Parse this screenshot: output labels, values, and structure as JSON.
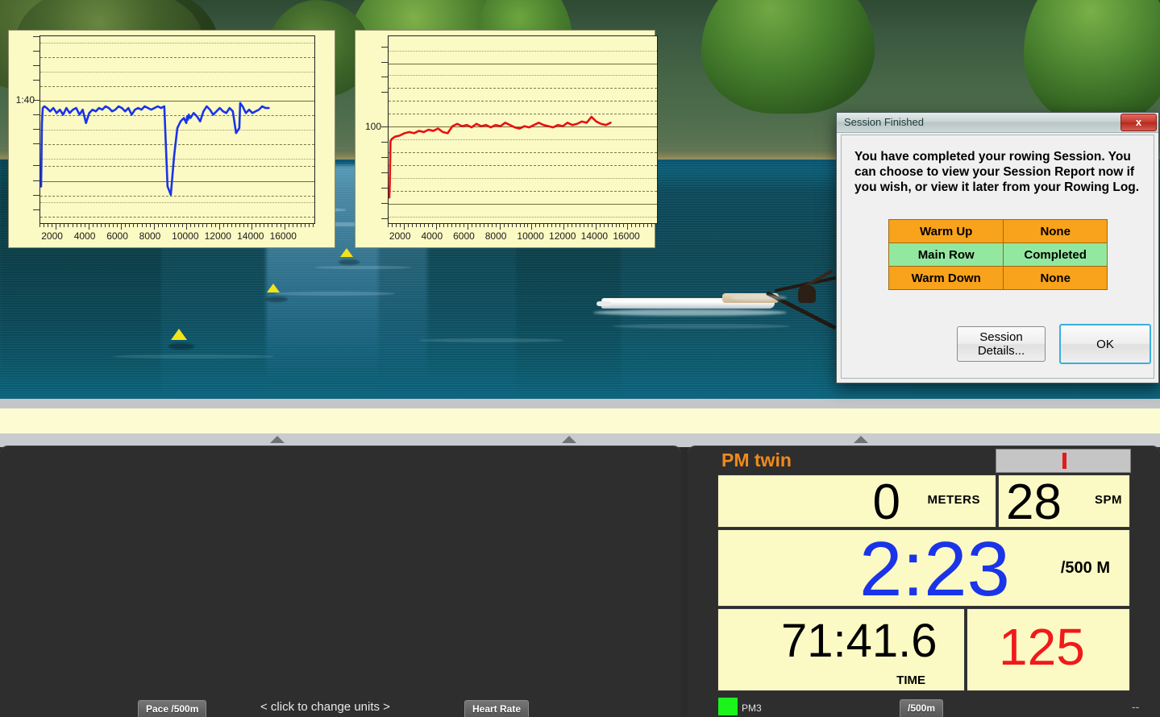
{
  "scene": {
    "name": "rowing-simulation-view",
    "buoys": 5,
    "boat": "single-scull"
  },
  "dialog": {
    "title": "Session Finished",
    "close_label": "x",
    "message": "You have completed your rowing Session.  You can choose to view your Session Report now if you wish, or view it later from your Rowing Log.",
    "table": {
      "rows": [
        {
          "label": "Warm Up",
          "status": "None",
          "color": "#f9a21b"
        },
        {
          "label": "Main Row",
          "status": "Completed",
          "color": "#93e8a0"
        },
        {
          "label": "Warm Down",
          "status": "None",
          "color": "#f9a21b"
        }
      ]
    },
    "buttons": {
      "details_line1": "Session",
      "details_line2": "Details...",
      "ok": "OK"
    }
  },
  "charts_panel": {
    "pace_button": "Pace /500m",
    "hr_button": "Heart Rate",
    "hint": "<  click to change units  >"
  },
  "pm": {
    "title": "PM twin",
    "progress_marker": "I",
    "distance_value": "0",
    "distance_unit": "METERS",
    "rate_value": "28",
    "rate_unit": "SPM",
    "pace_value": "2:23",
    "pace_unit": "/500 M",
    "time_value": "71:41.6",
    "time_unit": "TIME",
    "heart_rate_value": "125",
    "status_device": "PM3",
    "units_button": "/500m",
    "trailing": "--",
    "colors": {
      "title": "#f08a1c",
      "pace": "#1a34e8",
      "heart_rate": "#f01a1a",
      "panel_bg": "#fcfac4",
      "status_ok": "#1cf31c"
    }
  },
  "chart_data": [
    {
      "type": "line",
      "name": "pace-chart",
      "title": "",
      "xlabel": "",
      "ylabel": "",
      "series_name": "Pace /500m",
      "color": "#1a34e8",
      "xlim": [
        1000,
        17800
      ],
      "xticks": [
        2000,
        4000,
        6000,
        8000,
        10000,
        12000,
        14000,
        16000
      ],
      "xticklabels": [
        "2000",
        "4000",
        "6000",
        "8000",
        "10000",
        "12000",
        "14000",
        "16000"
      ],
      "yticklabels": [
        "1:40"
      ],
      "ytick_value": "1:40",
      "grid": true,
      "x": [
        1050,
        1100,
        1150,
        1250,
        1400,
        1600,
        1800,
        2000,
        2200,
        2400,
        2600,
        2800,
        3000,
        3200,
        3400,
        3600,
        3800,
        4000,
        4200,
        4400,
        4600,
        4800,
        5000,
        5200,
        5400,
        5600,
        5800,
        6000,
        6200,
        6400,
        6600,
        6800,
        7000,
        7200,
        7400,
        7600,
        7800,
        8000,
        8200,
        8400,
        8600,
        8800,
        9000,
        9200,
        9400,
        9600,
        9800,
        9950,
        10000,
        10050,
        10100,
        10200,
        10400,
        10600,
        10800,
        11000,
        11200,
        11400,
        11600,
        11800,
        12000,
        12200,
        12400,
        12600,
        12800,
        13000,
        13200,
        13250,
        13400,
        13600,
        13800,
        14000,
        14200,
        14400,
        14600,
        14800,
        15000
      ],
      "y": [
        2.4,
        2.02,
        1.93,
        1.92,
        1.93,
        1.95,
        1.93,
        1.96,
        1.94,
        1.97,
        1.93,
        1.96,
        1.94,
        1.93,
        1.97,
        1.94,
        2.02,
        1.96,
        1.94,
        1.95,
        1.93,
        1.94,
        1.92,
        1.93,
        1.95,
        1.94,
        1.92,
        1.93,
        1.95,
        1.93,
        1.97,
        1.94,
        1.93,
        1.94,
        1.92,
        1.93,
        1.94,
        1.93,
        1.92,
        1.93,
        1.92,
        2.4,
        2.45,
        2.22,
        2.05,
        2.01,
        1.99,
        2.02,
        1.98,
        2.0,
        1.97,
        1.99,
        1.96,
        1.98,
        2.01,
        1.95,
        1.92,
        1.94,
        1.97,
        1.95,
        1.93,
        1.95,
        1.96,
        1.93,
        1.95,
        2.08,
        2.05,
        1.9,
        1.92,
        1.96,
        1.94,
        1.96,
        1.95,
        1.94,
        1.92,
        1.93,
        1.93
      ]
    },
    {
      "type": "line",
      "name": "heart-rate-chart",
      "title": "",
      "xlabel": "",
      "ylabel": "",
      "series_name": "Heart Rate",
      "color": "#e81010",
      "xlim": [
        1000,
        17800
      ],
      "xticks": [
        2000,
        4000,
        6000,
        8000,
        10000,
        12000,
        14000,
        16000
      ],
      "xticklabels": [
        "2000",
        "4000",
        "6000",
        "8000",
        "10000",
        "12000",
        "14000",
        "16000"
      ],
      "yticklabels": [
        "100"
      ],
      "ytick_value": "100",
      "grid": true,
      "x": [
        1050,
        1080,
        1120,
        1200,
        1400,
        1700,
        2000,
        2300,
        2600,
        2900,
        3200,
        3500,
        3800,
        4100,
        4400,
        4700,
        5000,
        5300,
        5600,
        5900,
        6200,
        6500,
        6800,
        7100,
        7400,
        7700,
        8000,
        8300,
        8600,
        8900,
        9200,
        9500,
        9800,
        10100,
        10400,
        10700,
        11000,
        11300,
        11600,
        11900,
        12200,
        12500,
        12800,
        13100,
        13400,
        13700,
        14000,
        14300,
        14600,
        14900
      ],
      "y": [
        62,
        75,
        110,
        112,
        114,
        115,
        117,
        118,
        117,
        119,
        118,
        120,
        119,
        121,
        118,
        117,
        123,
        125,
        123,
        124,
        122,
        125,
        123,
        124,
        122,
        124,
        123,
        126,
        124,
        122,
        121,
        123,
        122,
        124,
        126,
        124,
        123,
        122,
        124,
        123,
        126,
        124,
        125,
        127,
        126,
        131,
        127,
        125,
        124,
        126
      ],
      "ylim": [
        40,
        200
      ]
    }
  ]
}
